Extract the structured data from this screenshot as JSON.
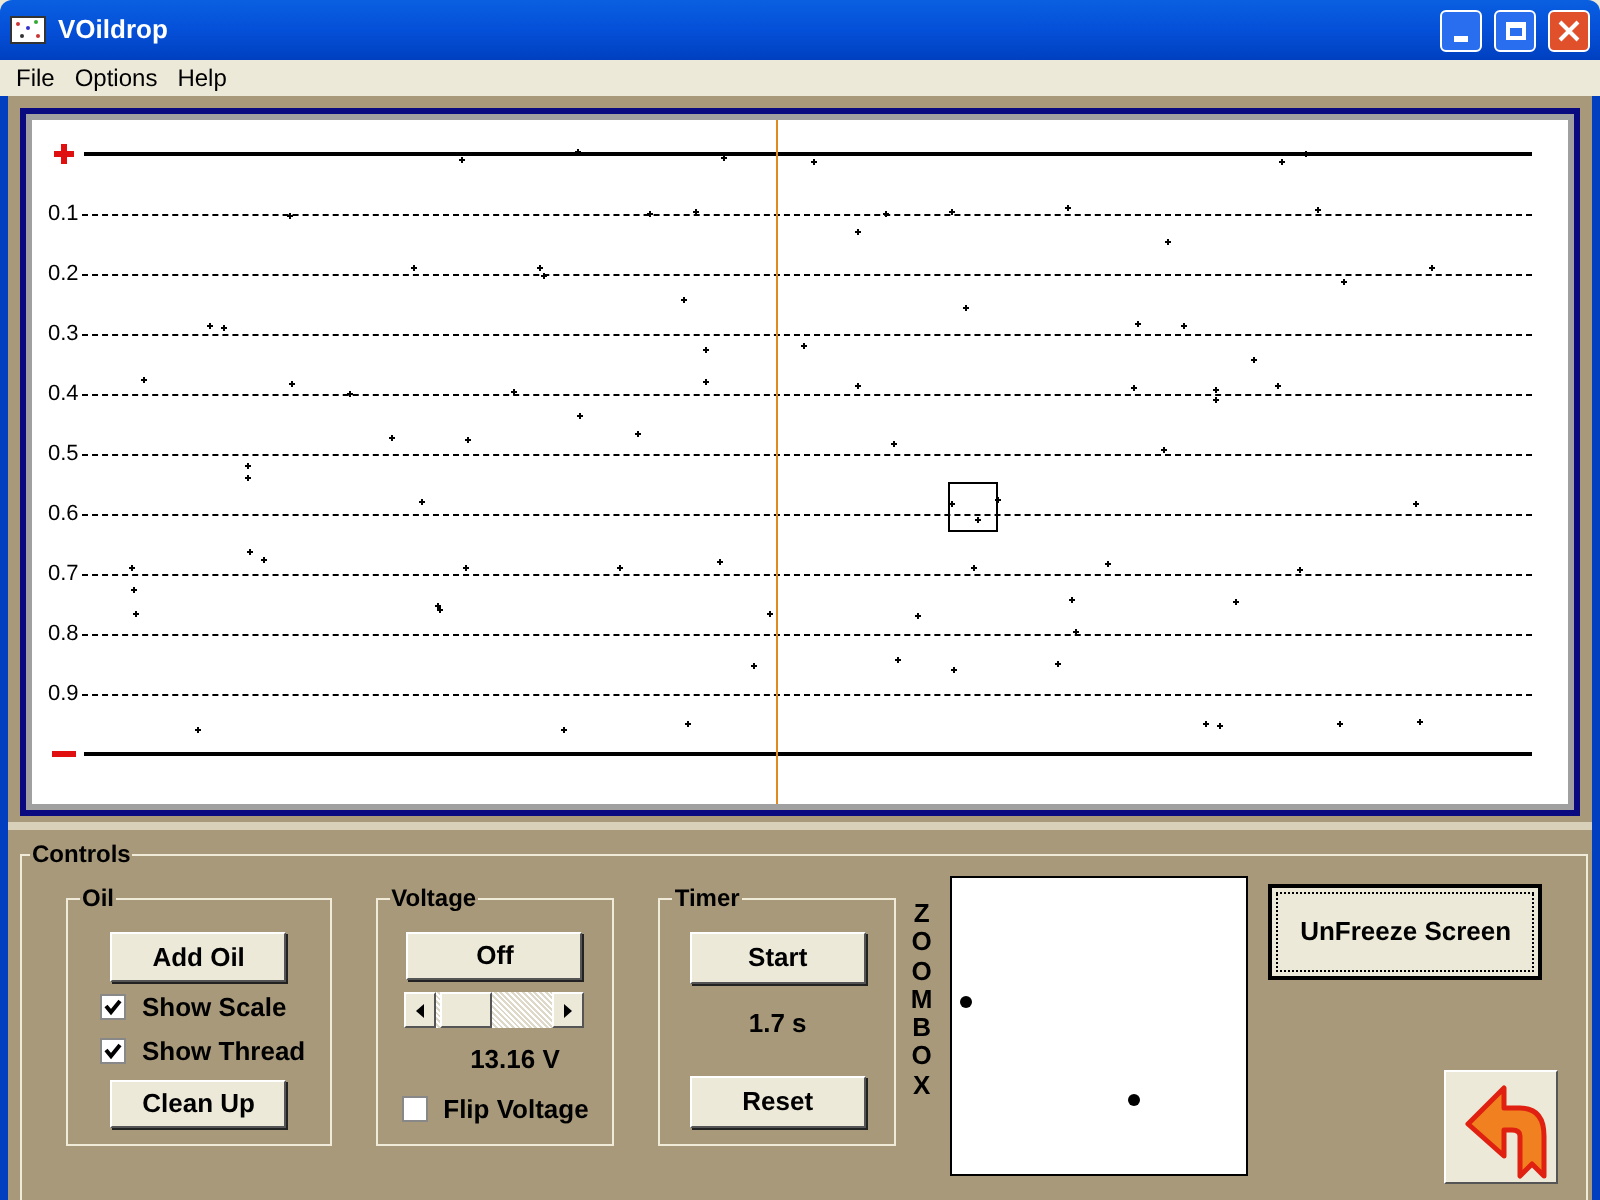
{
  "window": {
    "title": "VOildrop"
  },
  "menu": [
    "File",
    "Options",
    "Help"
  ],
  "chamber": {
    "scale_labels": [
      "0.1",
      "0.2",
      "0.3",
      "0.4",
      "0.5",
      "0.6",
      "0.7",
      "0.8",
      "0.9"
    ]
  },
  "controls": {
    "title": "Controls",
    "oil": {
      "title": "Oil",
      "add_button": "Add Oil",
      "checkboxes": [
        {
          "label": "Show Scale",
          "checked": true
        },
        {
          "label": "Show Thread",
          "checked": true
        }
      ],
      "cleanup_button": "Clean Up"
    },
    "voltage": {
      "title": "Voltage",
      "button": "Off",
      "slider": {
        "level": 0.05
      },
      "reading": "13.16 V",
      "flip": {
        "label": "Flip Voltage",
        "checked": false
      }
    },
    "timer": {
      "title": "Timer",
      "start_button": "Start",
      "reading": "1.7 s",
      "reset_button": "Reset"
    },
    "zoom_box": {
      "label": "ZOOM BOX"
    },
    "unfreeze_button": "UnFreeze Screen"
  }
}
